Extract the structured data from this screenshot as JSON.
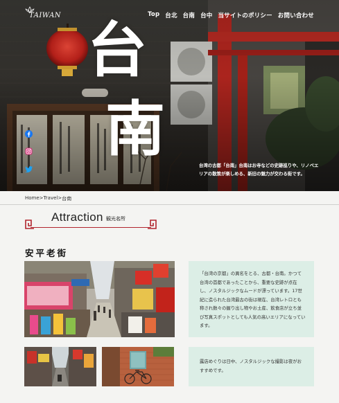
{
  "header": {
    "logo_text": "TAIWAN",
    "nav": [
      "Top",
      "台北",
      "台南",
      "台中",
      "当サイトのポリシー",
      "お問い合わせ"
    ]
  },
  "hero": {
    "kanji_top": "台",
    "kanji_bottom": "南",
    "caption": "台湾の古都「台南」台南はお寺などの史跡巡りや、リノベエリアの散策が楽しめる、新旧の魅力が交わる街です。",
    "social_icons": [
      "facebook-icon",
      "instagram-icon",
      "twitter-icon"
    ]
  },
  "breadcrumb": {
    "items": [
      "Home",
      ">",
      "Travel",
      ">",
      "台南"
    ]
  },
  "section": {
    "title": "Attraction",
    "subtitle": "観光名所"
  },
  "spot": {
    "name": "安平老街",
    "description_1": "「台湾の京都」の異名をとる、古都・台南。かつて台湾の首都であったことから、重要な史跡が点在し、ノスタルジックなムードが漂っています。17世紀に造られた台湾最古の街は現在、台湾レトロとも称され数々の握り出し物やお土産、飲食店が立ち並び写真スポットとしても人気の高いエリアになっています。",
    "description_2": "露店めぐりは日中、ノスタルジックな撮影は夜がおすすめです。"
  },
  "colors": {
    "accent_red": "#b1242d",
    "panel_mint": "#dceee6",
    "page_bg": "#f4f4f2"
  }
}
